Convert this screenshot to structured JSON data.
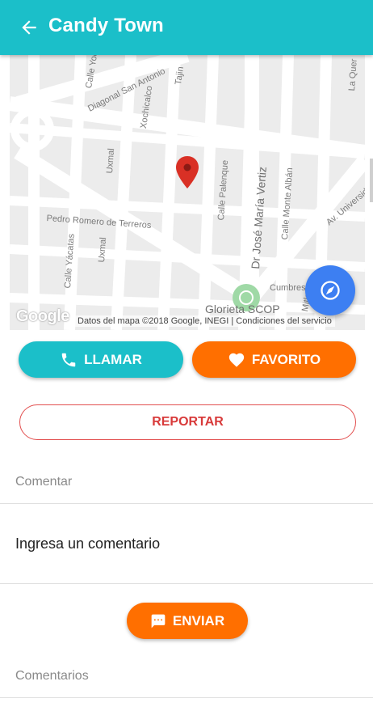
{
  "header": {
    "title": "Candy Town",
    "back_icon": "arrow-left-icon"
  },
  "map": {
    "streets": [
      "Diagonal San Antonio",
      "Calle Yoce",
      "Xochicalco",
      "Tajin",
      "Uxmal",
      "Uxmal",
      "Calle Palenque",
      "Dr José María Vertiz",
      "Calle Monte Albán",
      "Pedro Romero de Terreros",
      "Calle Yácatas",
      "Av. Universidad",
      "La Quer",
      "Cumbres",
      "Mitla"
    ],
    "place_label": "Glorieta SCOP",
    "logo": "Google",
    "attribution": "Datos del mapa ©2018 Google, INEGI",
    "terms": "Condiciones del servicio",
    "pin_icon": "map-pin-icon",
    "compass_icon": "compass-icon",
    "accent_color": "#3d7ff2"
  },
  "actions": {
    "call_label": "LLAMAR",
    "favorite_label": "FAVORITO",
    "report_label": "REPORTAR",
    "call_color": "#1bbfc9",
    "favorite_color": "#ff6f00"
  },
  "comment": {
    "section_label": "Comentar",
    "placeholder": "Ingresa un comentario",
    "send_label": "ENVIAR"
  },
  "comments": {
    "section_label": "Comentarios"
  }
}
